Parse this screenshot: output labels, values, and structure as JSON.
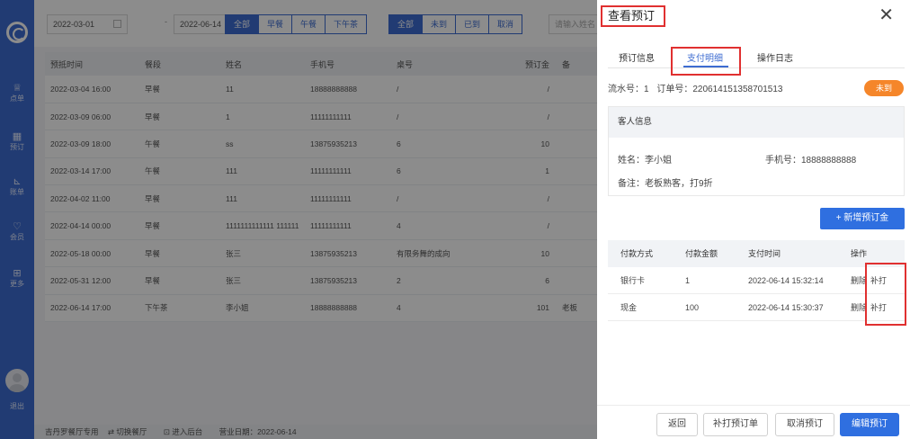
{
  "nav": {
    "items": [
      {
        "icon": "checklist-icon",
        "label": "点单"
      },
      {
        "icon": "calendar-icon",
        "label": "预订"
      },
      {
        "icon": "chart-icon",
        "label": "账单"
      },
      {
        "icon": "location-icon",
        "label": "会员"
      },
      {
        "icon": "grid-icon",
        "label": "更多"
      }
    ],
    "logout": "退出"
  },
  "filters": {
    "date_from": "2022-03-01",
    "date_to": "2022-06-14",
    "date_sep": "-",
    "meal_options": [
      "全部",
      "早餐",
      "午餐",
      "下午茶"
    ],
    "status_options": [
      "全部",
      "未到",
      "已到",
      "取消"
    ],
    "search_placeholder": "请输入姓名"
  },
  "table": {
    "headers": [
      "预抵时间",
      "餐段",
      "姓名",
      "手机号",
      "桌号",
      "预订金",
      "备"
    ],
    "rows": [
      [
        "2022-03-04 16:00",
        "早餐",
        "11",
        "18888888888",
        "/",
        "/",
        ""
      ],
      [
        "2022-03-09 06:00",
        "早餐",
        "1",
        "11111111111",
        "/",
        "/",
        ""
      ],
      [
        "2022-03-09 18:00",
        "午餐",
        "ss",
        "13875935213",
        "6",
        "10",
        ""
      ],
      [
        "2022-03-14 17:00",
        "午餐",
        "111",
        "11111111111",
        "6",
        "1",
        ""
      ],
      [
        "2022-04-02 11:00",
        "早餐",
        "111",
        "11111111111",
        "/",
        "/",
        ""
      ],
      [
        "2022-04-14 00:00",
        "早餐",
        "1111111111111 111111",
        "11111111111",
        "4",
        "/",
        ""
      ],
      [
        "2022-05-18 00:00",
        "早餐",
        "张三",
        "13875935213",
        "有限务舞的成向",
        "10",
        ""
      ],
      [
        "2022-05-31 12:00",
        "早餐",
        "张三",
        "13875935213",
        "2",
        "6",
        ""
      ],
      [
        "2022-06-14 17:00",
        "下午茶",
        "李小姐",
        "18888888888",
        "4",
        "101",
        "老板"
      ]
    ]
  },
  "footer": {
    "store": "吉丹罗餐厅专用",
    "switch": "切换餐厅",
    "backend": "进入后台",
    "bizdate": "营业日期：2022-06-14"
  },
  "drawer": {
    "title": "查看预订",
    "tabs": [
      "预订信息",
      "支付明细",
      "操作日志"
    ],
    "serial_label": "流水号：",
    "serial": "1",
    "order_label": "订单号：",
    "order": "220614151358701513",
    "status": "未到",
    "guest_header": "客人信息",
    "name_label": "姓名：",
    "name": "李小姐",
    "phone_label": "手机号：",
    "phone": "18888888888",
    "remark_label": "备注：",
    "remark": "老板熟客，打9折",
    "add_deposit": "+ 新增预订金",
    "pay_headers": [
      "付款方式",
      "付款金额",
      "支付时间",
      "操作"
    ],
    "payments": [
      {
        "method": "银行卡",
        "amount": "1",
        "time": "2022-06-14 15:32:14",
        "delete": "删除",
        "reprint": "补打"
      },
      {
        "method": "现金",
        "amount": "100",
        "time": "2022-06-14 15:30:37",
        "delete": "删除",
        "reprint": "补打"
      }
    ],
    "buttons": [
      "返回",
      "补打预订单",
      "取消预订",
      "编辑预订"
    ]
  },
  "colors": {
    "primary": "#3d6cd1",
    "button": "#2f6fe0",
    "badge": "#f5862a",
    "highlight": "#e03030"
  }
}
